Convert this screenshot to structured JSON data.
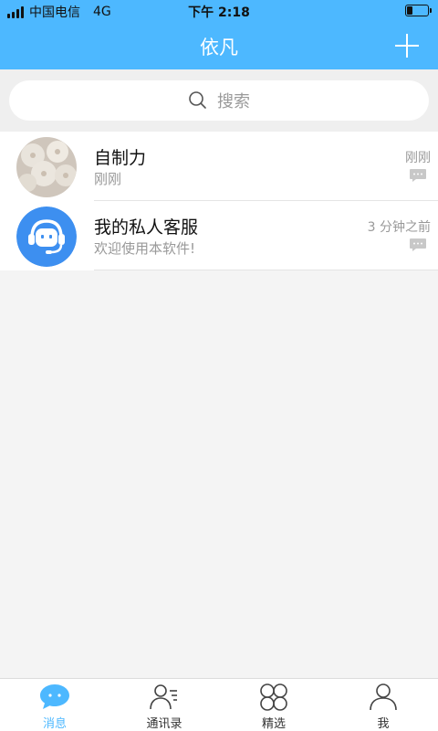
{
  "status_bar": {
    "carrier": "中国电信",
    "network": "4G",
    "time": "下午 2:18",
    "battery_level": 0.3
  },
  "nav": {
    "title": "依凡",
    "add_icon": "plus-icon"
  },
  "search": {
    "placeholder": "搜索",
    "icon": "search-icon"
  },
  "conversations": [
    {
      "name": "自制力",
      "preview": "刚刚",
      "time": "刚刚",
      "avatar": "photo-avatar"
    },
    {
      "name": "我的私人客服",
      "preview": "欢迎使用本软件!",
      "time": "3 分钟之前",
      "avatar": "headset-avatar"
    }
  ],
  "tabs": [
    {
      "label": "消息",
      "icon": "chat-bubble-icon",
      "active": true
    },
    {
      "label": "通讯录",
      "icon": "contacts-icon",
      "active": false
    },
    {
      "label": "精选",
      "icon": "grid-circles-icon",
      "active": false
    },
    {
      "label": "我",
      "icon": "person-icon",
      "active": false
    }
  ],
  "colors": {
    "accent": "#4db8ff",
    "text_secondary": "#999999"
  }
}
